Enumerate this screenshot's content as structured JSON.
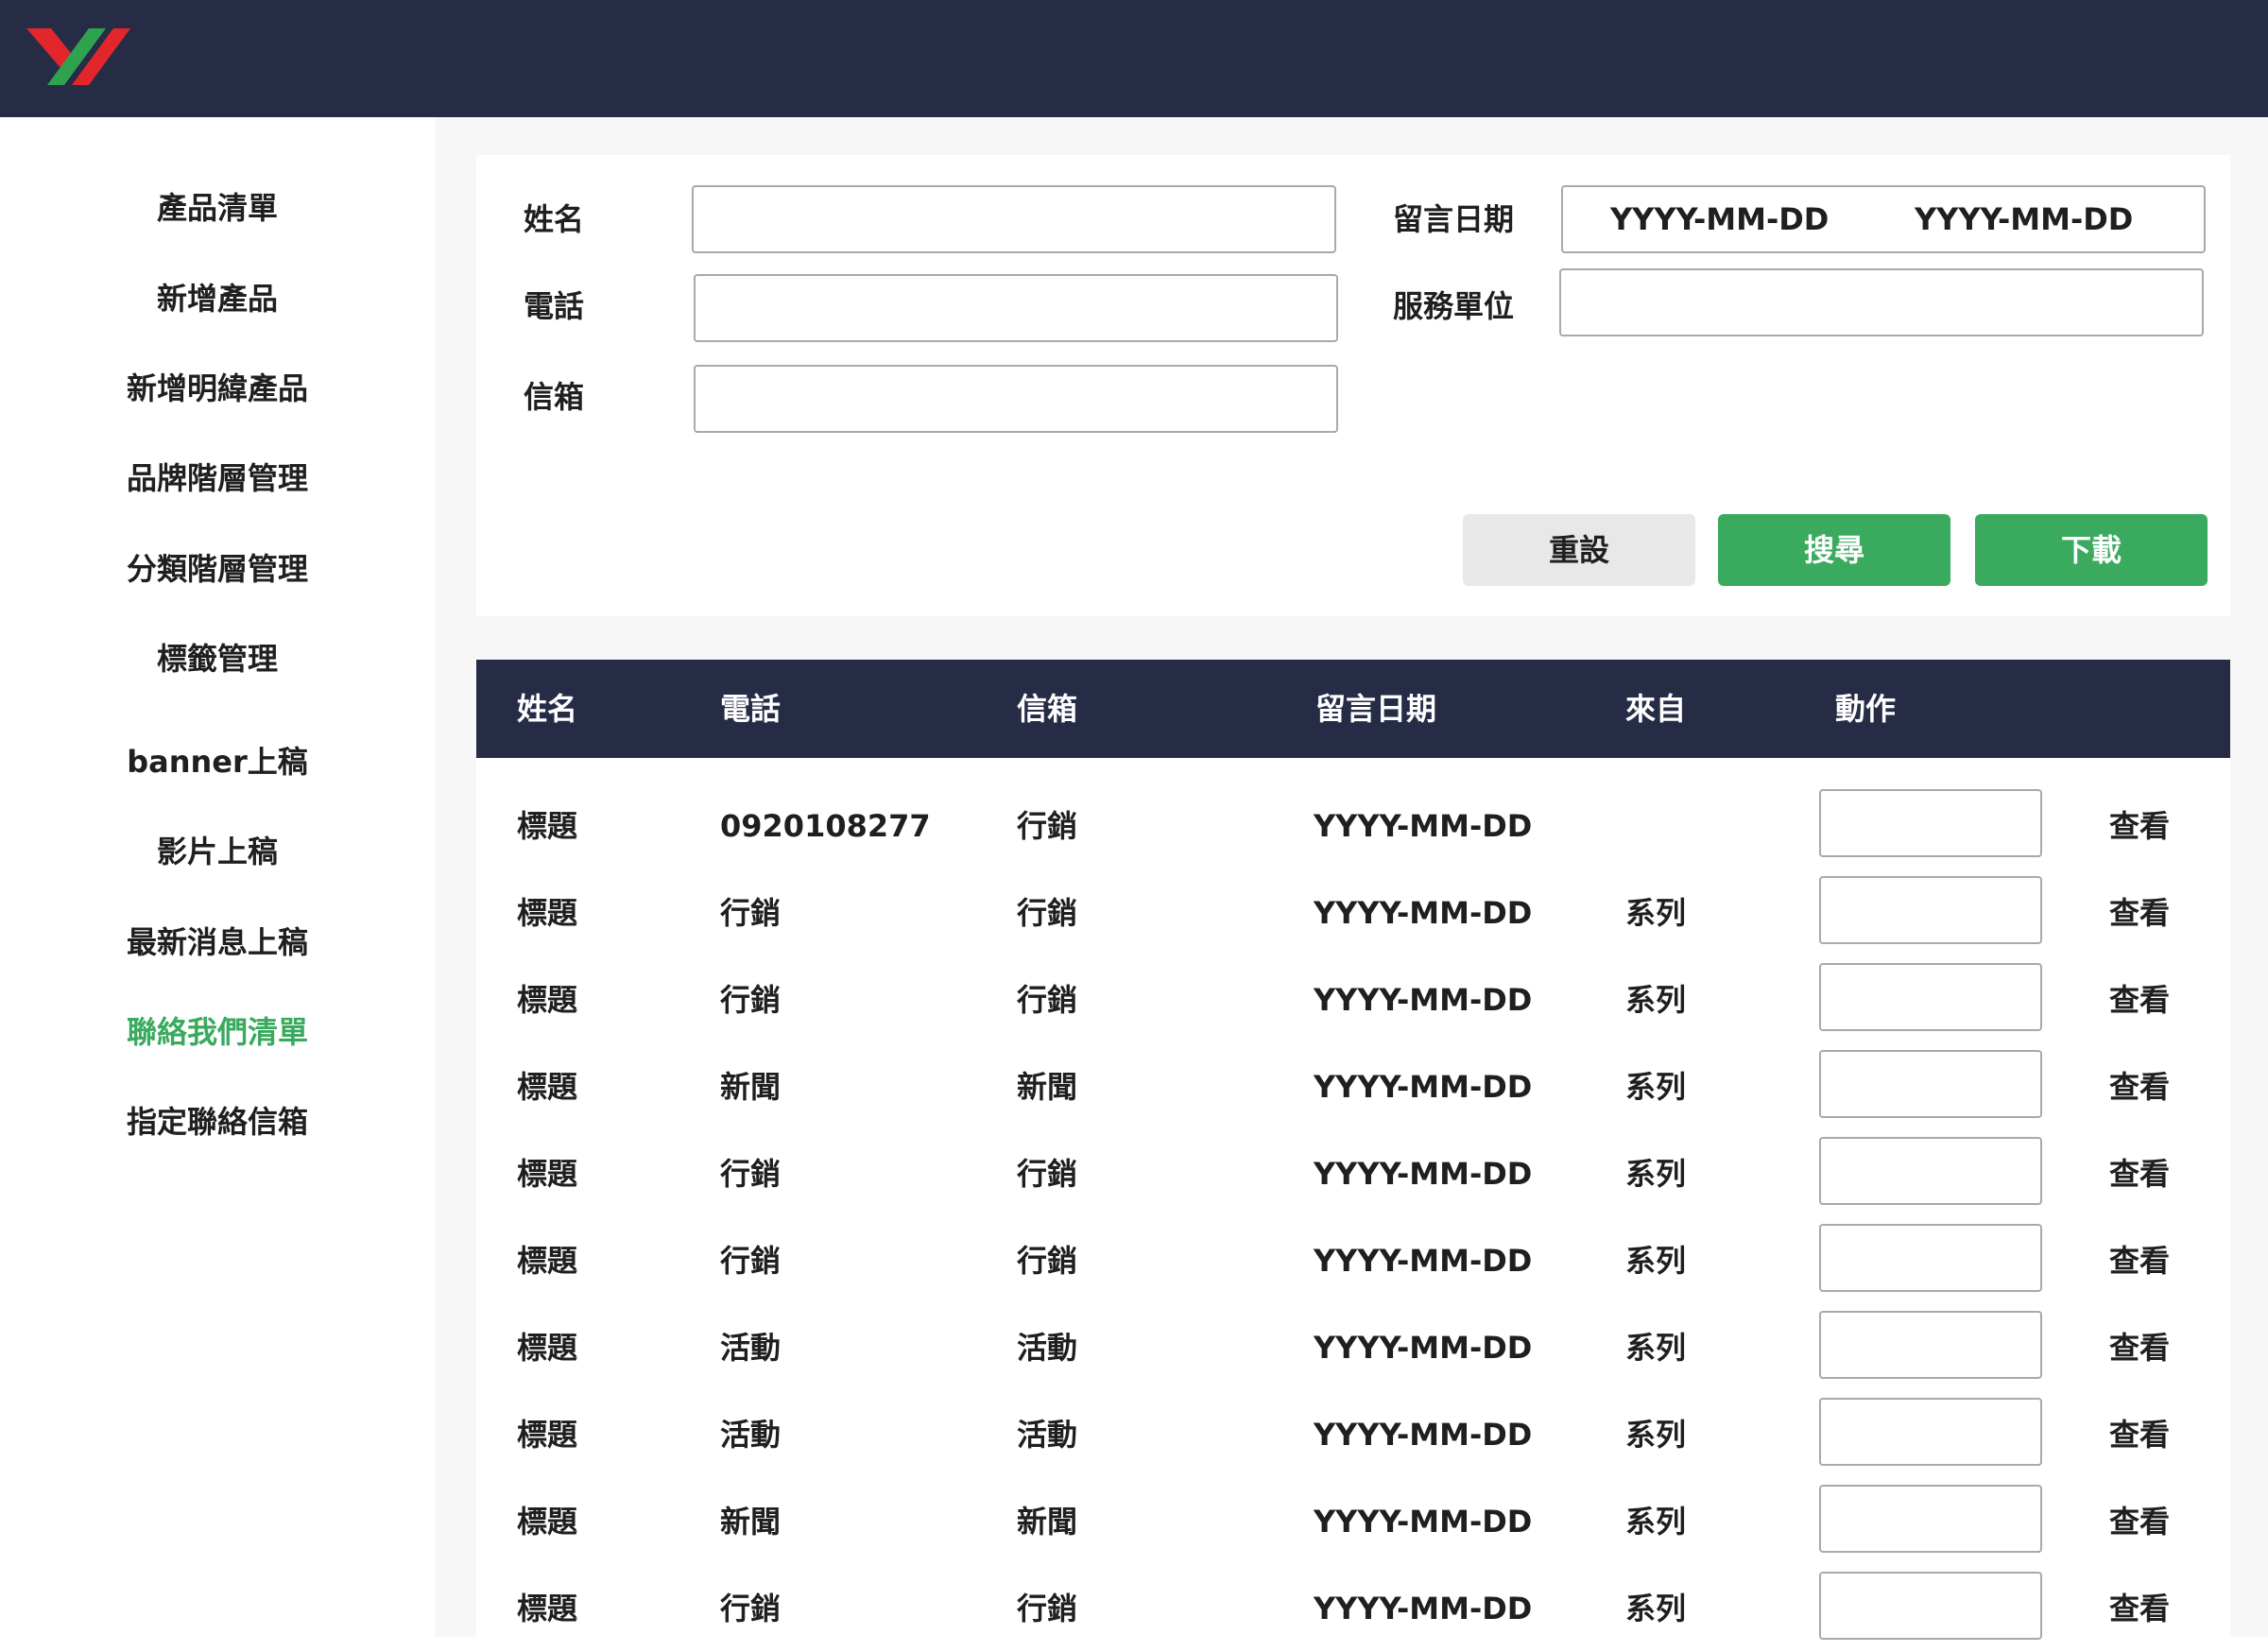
{
  "colors": {
    "header_bg": "#272c46",
    "accent_green": "#3aaa5f",
    "logo_red": "#e3262c",
    "logo_green": "#2fa24f"
  },
  "logo": {
    "icon": "brand-logo-icon"
  },
  "sidebar": {
    "items": [
      {
        "label": "產品清單",
        "active": false
      },
      {
        "label": "新增產品",
        "active": false
      },
      {
        "label": "新增明緯產品",
        "active": false
      },
      {
        "label": "品牌階層管理",
        "active": false
      },
      {
        "label": "分類階層管理",
        "active": false
      },
      {
        "label": "標籤管理",
        "active": false
      },
      {
        "label": "banner上稿",
        "active": false
      },
      {
        "label": "影片上稿",
        "active": false
      },
      {
        "label": "最新消息上稿",
        "active": false
      },
      {
        "label": "聯絡我們清單",
        "active": true
      },
      {
        "label": "指定聯絡信箱",
        "active": false
      }
    ]
  },
  "search": {
    "name_label": "姓名",
    "phone_label": "電話",
    "email_label": "信箱",
    "date_label": "留言日期",
    "unit_label": "服務單位",
    "date_from": "YYYY-MM-DD",
    "date_to": "YYYY-MM-DD",
    "reset_label": "重設",
    "search_label": "搜尋",
    "download_label": "下載"
  },
  "table": {
    "headers": [
      "姓名",
      "電話",
      "信箱",
      "留言日期",
      "來自",
      "動作"
    ],
    "view_label": "查看",
    "rows": [
      {
        "name": "標題",
        "phone": "0920108277",
        "email": "行銷",
        "date": "YYYY-MM-DD",
        "source": ""
      },
      {
        "name": "標題",
        "phone": "行銷",
        "email": "行銷",
        "date": "YYYY-MM-DD",
        "source": "系列"
      },
      {
        "name": "標題",
        "phone": "行銷",
        "email": "行銷",
        "date": "YYYY-MM-DD",
        "source": "系列"
      },
      {
        "name": "標題",
        "phone": "新聞",
        "email": "新聞",
        "date": "YYYY-MM-DD",
        "source": "系列"
      },
      {
        "name": "標題",
        "phone": "行銷",
        "email": "行銷",
        "date": "YYYY-MM-DD",
        "source": "系列"
      },
      {
        "name": "標題",
        "phone": "行銷",
        "email": "行銷",
        "date": "YYYY-MM-DD",
        "source": "系列"
      },
      {
        "name": "標題",
        "phone": "活動",
        "email": "活動",
        "date": "YYYY-MM-DD",
        "source": "系列"
      },
      {
        "name": "標題",
        "phone": "活動",
        "email": "活動",
        "date": "YYYY-MM-DD",
        "source": "系列"
      },
      {
        "name": "標題",
        "phone": "新聞",
        "email": "新聞",
        "date": "YYYY-MM-DD",
        "source": "系列"
      },
      {
        "name": "標題",
        "phone": "行銷",
        "email": "行銷",
        "date": "YYYY-MM-DD",
        "source": "系列"
      }
    ]
  }
}
